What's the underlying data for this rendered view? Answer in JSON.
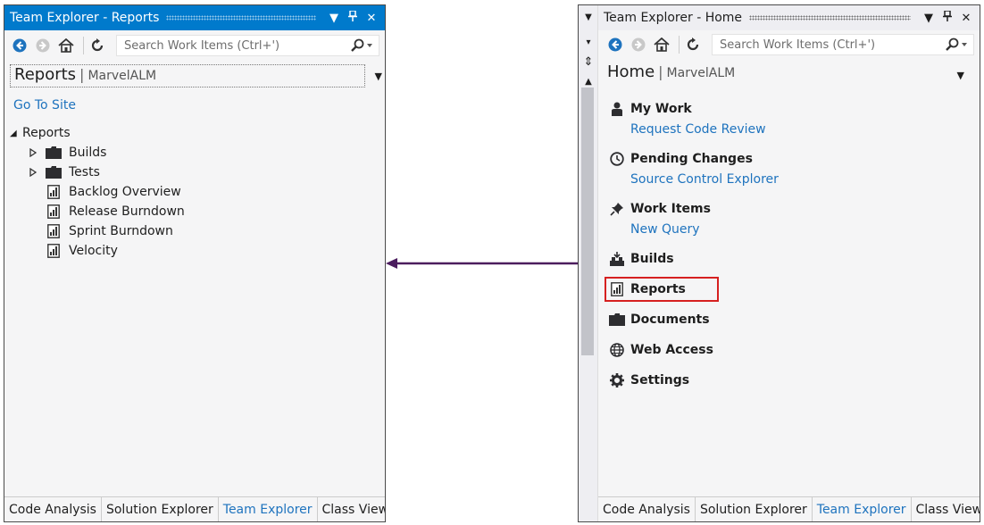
{
  "colors": {
    "accent": "#007acc",
    "link": "#1e73be",
    "highlight": "#d62020",
    "arrow": "#4b1d5e"
  },
  "left": {
    "title": "Team Explorer - Reports",
    "search": {
      "placeholder": "Search Work Items (Ctrl+')"
    },
    "header": {
      "title": "Reports",
      "sub": "MarvelALM"
    },
    "go_to_site": "Go To Site",
    "tree": {
      "root": "Reports",
      "folders": [
        "Builds",
        "Tests"
      ],
      "reports": [
        "Backlog Overview",
        "Release Burndown",
        "Sprint Burndown",
        "Velocity"
      ]
    },
    "tabs": [
      "Code Analysis",
      "Solution Explorer",
      "Team Explorer",
      "Class View"
    ],
    "active_tab": "Team Explorer"
  },
  "right": {
    "title": "Team Explorer - Home",
    "search": {
      "placeholder": "Search Work Items (Ctrl+')"
    },
    "header": {
      "title": "Home",
      "sub": "MarvelALM"
    },
    "sections": {
      "my_work": {
        "label": "My Work",
        "link": "Request Code Review"
      },
      "pending_changes": {
        "label": "Pending Changes",
        "link": "Source Control Explorer"
      },
      "work_items": {
        "label": "Work Items",
        "link": "New Query"
      },
      "builds": {
        "label": "Builds"
      },
      "reports": {
        "label": "Reports"
      },
      "documents": {
        "label": "Documents"
      },
      "web_access": {
        "label": "Web Access"
      },
      "settings": {
        "label": "Settings"
      }
    },
    "tabs": [
      "Code Analysis",
      "Solution Explorer",
      "Team Explorer",
      "Class View"
    ],
    "active_tab": "Team Explorer"
  }
}
